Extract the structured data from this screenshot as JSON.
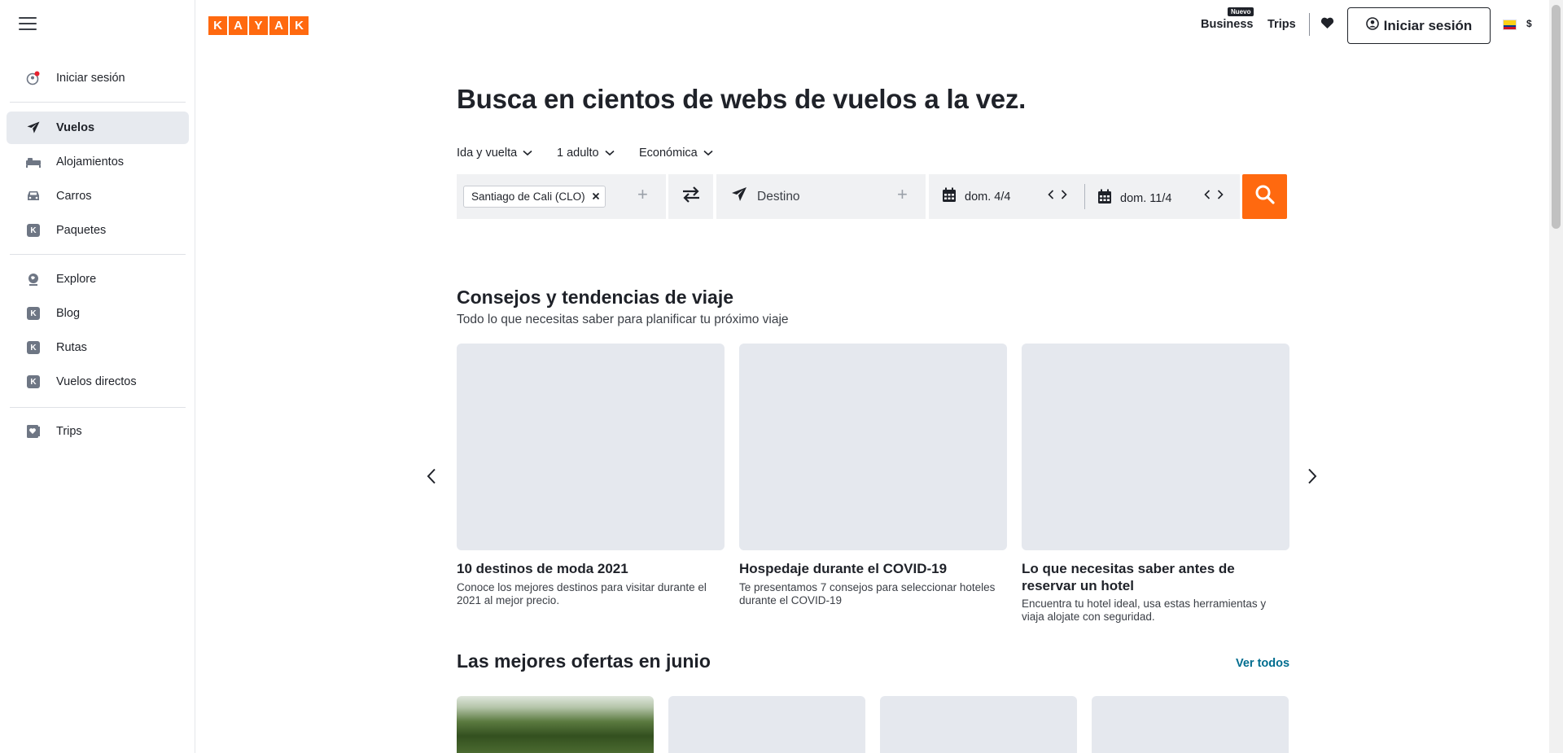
{
  "sidebar": {
    "items": [
      {
        "label": "Iniciar sesión",
        "icon": "user-notification-icon"
      },
      {
        "label": "Vuelos",
        "icon": "plane-icon",
        "active": true
      },
      {
        "label": "Alojamientos",
        "icon": "bed-icon"
      },
      {
        "label": "Carros",
        "icon": "car-icon"
      },
      {
        "label": "Paquetes",
        "icon": "kayak-k-icon"
      },
      {
        "label": "Explore",
        "icon": "globe-icon"
      },
      {
        "label": "Blog",
        "icon": "kayak-k-icon"
      },
      {
        "label": "Rutas",
        "icon": "kayak-k-icon"
      },
      {
        "label": "Vuelos directos",
        "icon": "kayak-k-icon"
      },
      {
        "label": "Trips",
        "icon": "trips-heart-icon"
      }
    ],
    "kbadge": "K"
  },
  "header": {
    "logo_letters": [
      "K",
      "A",
      "Y",
      "A",
      "K"
    ],
    "nuevo_badge": "Nuevo",
    "business": "Business",
    "trips": "Trips",
    "login": "Iniciar sesión",
    "currency": "$",
    "accent": "#ff690f"
  },
  "hero": {
    "title": "Busca en cientos de webs de vuelos a la vez.",
    "trip_type": "Ida y vuelta",
    "travelers": "1 adulto",
    "cabin": "Económica",
    "origin": "Santiago de Cali (CLO)",
    "destination_placeholder": "Destino",
    "depart_date": "dom. 4/4",
    "return_date": "dom. 11/4"
  },
  "tips": {
    "title": "Consejos y tendencias de viaje",
    "subtitle": "Todo lo que necesitas saber para planificar tu próximo viaje",
    "cards": [
      {
        "title": "10 destinos de moda 2021",
        "desc": "Conoce los mejores destinos para visitar durante el 2021 al mejor precio."
      },
      {
        "title": "Hospedaje durante el COVID-19",
        "desc": "Te presentamos 7 consejos para seleccionar hoteles durante el COVID-19"
      },
      {
        "title": "Lo que necesitas saber antes de reservar un hotel",
        "desc": "Encuentra tu hotel ideal, usa estas herramientas y viaja alojate con seguridad."
      }
    ]
  },
  "deals": {
    "title": "Las mejores ofertas en junio",
    "see_all": "Ver todos"
  }
}
